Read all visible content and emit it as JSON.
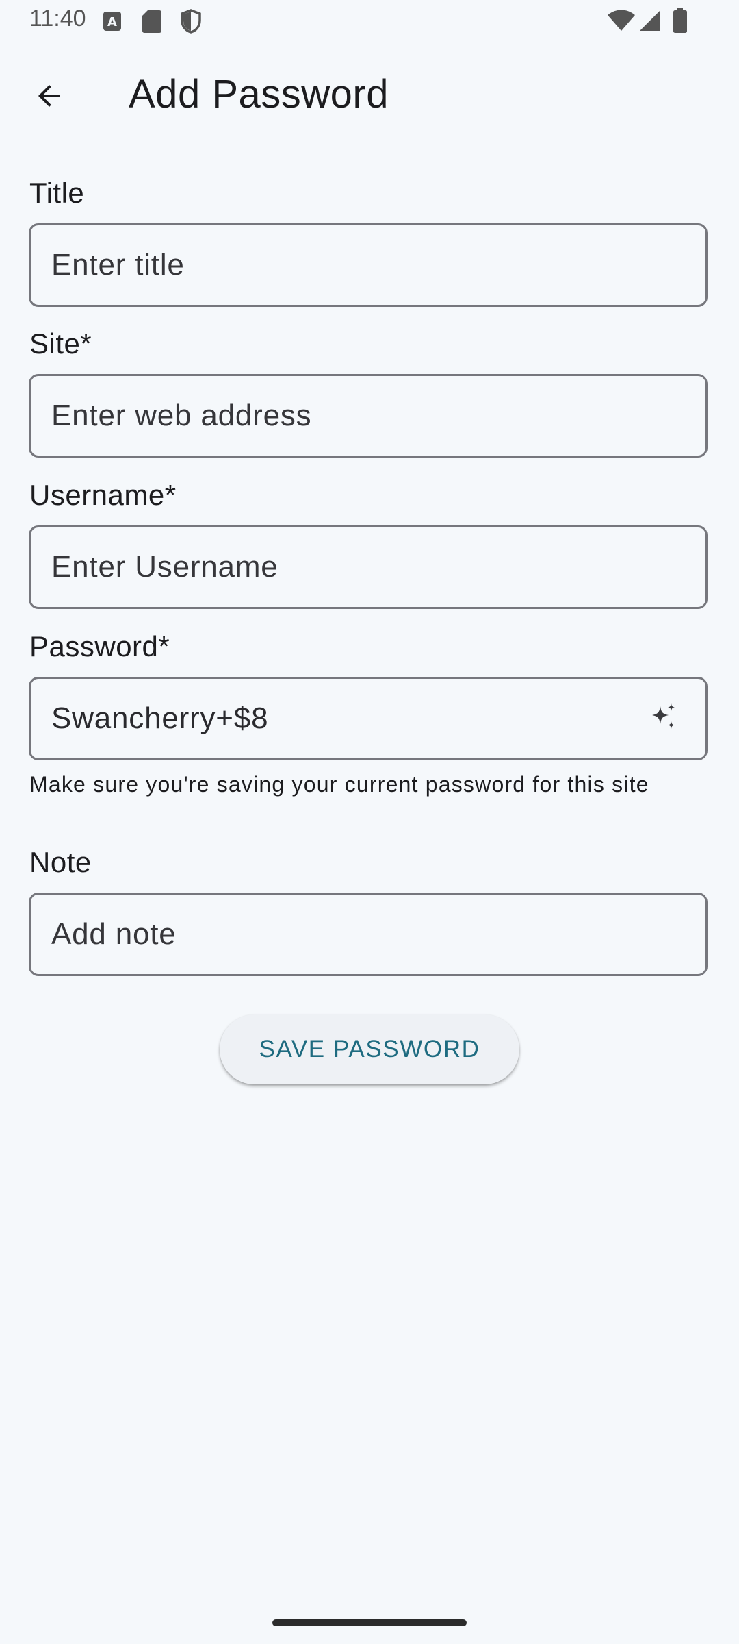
{
  "status_bar": {
    "time": "11:40",
    "left_icons": [
      "a11y-icon",
      "sd-card-icon",
      "shield-icon"
    ],
    "right_icons": [
      "wifi-icon",
      "signal-icon",
      "battery-icon"
    ]
  },
  "app_bar": {
    "back_icon": "arrow-left-icon",
    "title": "Add Password"
  },
  "form": {
    "title": {
      "label": "Title",
      "placeholder": "Enter title"
    },
    "site": {
      "label": "Site*",
      "placeholder": "Enter web address"
    },
    "username": {
      "label": "Username*",
      "placeholder": "Enter Username"
    },
    "password": {
      "label": "Password*",
      "value": "Swancherry+$8",
      "generate_icon": "sparkle-icon",
      "helper": " Make sure you're saving your current password for this site"
    },
    "note": {
      "label": "Note",
      "placeholder": "Add note"
    }
  },
  "actions": {
    "save_label": "SAVE PASSWORD"
  },
  "colors": {
    "background": "#f5f8fb",
    "outline": "#76777d",
    "accent": "#1e6b80"
  }
}
